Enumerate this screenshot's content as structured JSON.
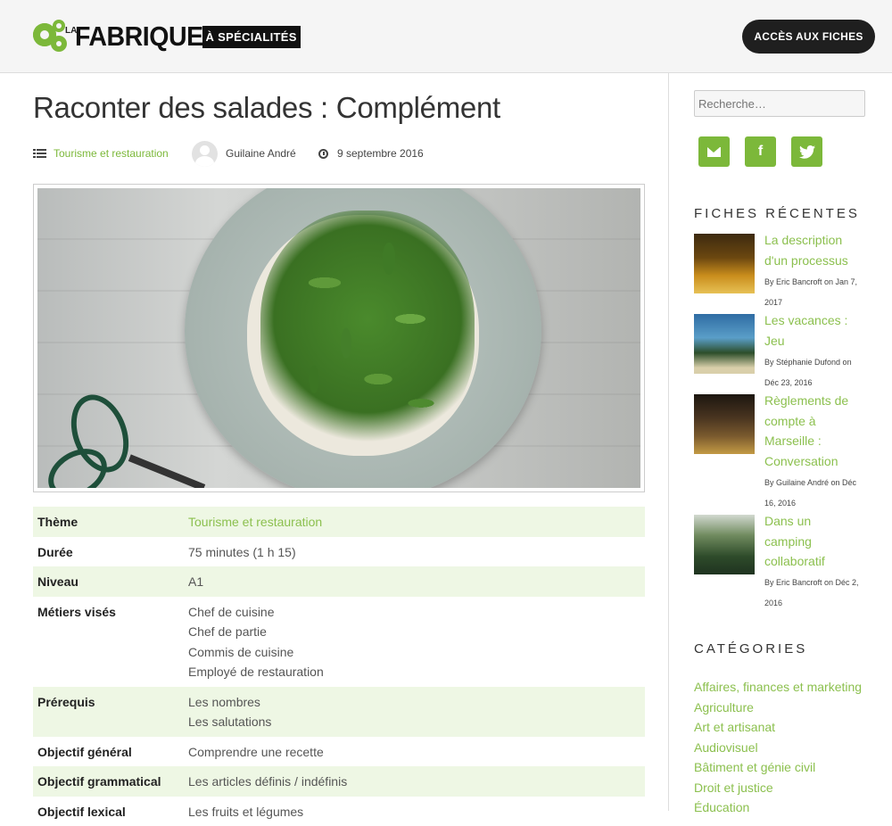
{
  "header": {
    "logo": {
      "small": "LA",
      "main": "FABRIQUE",
      "tag": "À SPÉCIALITÉS"
    },
    "cta_label": "ACCÈS AUX FICHES"
  },
  "post": {
    "title": "Raconter des salades : Complément",
    "category": "Tourisme et restauration",
    "author": "Guilaine André",
    "date": "9 septembre 2016"
  },
  "info_rows": [
    {
      "key": "Thème",
      "values": [
        "Tourisme et restauration"
      ],
      "link": true
    },
    {
      "key": "Durée",
      "values": [
        "75 minutes (1 h 15)"
      ]
    },
    {
      "key": "Niveau",
      "values": [
        "A1"
      ]
    },
    {
      "key": "Métiers visés",
      "values": [
        "Chef de cuisine",
        "Chef de partie",
        "Commis de cuisine",
        "Employé de restauration"
      ]
    },
    {
      "key": "Prérequis",
      "values": [
        "Les nombres",
        "Les salutations"
      ]
    },
    {
      "key": "Objectif général",
      "values": [
        "Comprendre une recette"
      ]
    },
    {
      "key": "Objectif grammatical",
      "values": [
        "Les articles définis / indéfinis"
      ]
    },
    {
      "key": "Objectif lexical",
      "values": [
        "Les fruits et légumes"
      ]
    }
  ],
  "sidebar": {
    "search_placeholder": "Recherche…",
    "socials": [
      {
        "icon": "email-icon"
      },
      {
        "icon": "facebook-icon",
        "glyph": "f"
      },
      {
        "icon": "twitter-icon"
      }
    ],
    "recent_title": "FICHES RÉCENTES",
    "recent": [
      {
        "title_lines": [
          "La description",
          "d'un processus"
        ],
        "by_lines": [
          "By Eric Bancroft on Jan 7,",
          "2017"
        ]
      },
      {
        "title_lines": [
          "Les vacances :",
          "Jeu"
        ],
        "by_lines": [
          "By Stéphanie Dufond on",
          "Déc 23, 2016"
        ]
      },
      {
        "title_lines": [
          "Règlements de",
          "compte à",
          "Marseille :",
          "Conversation"
        ],
        "by_lines": [
          "By Guilaine André on Déc",
          "16, 2016"
        ]
      },
      {
        "title_lines": [
          "Dans un",
          "camping",
          "collaboratif"
        ],
        "by_lines": [
          "By Eric Bancroft on Déc 2,",
          "2016"
        ]
      }
    ],
    "categories_title": "CATÉGORIES",
    "categories": [
      "Affaires, finances et marketing",
      "Agriculture",
      "Art et artisanat",
      "Audiovisuel",
      "Bâtiment et génie civil",
      "Droit et justice",
      "Éducation"
    ]
  },
  "colors": {
    "accent": "#7cb83a",
    "link": "#8cc04f",
    "row_alt": "#eef7e4",
    "cta": "#1f1f1f"
  }
}
